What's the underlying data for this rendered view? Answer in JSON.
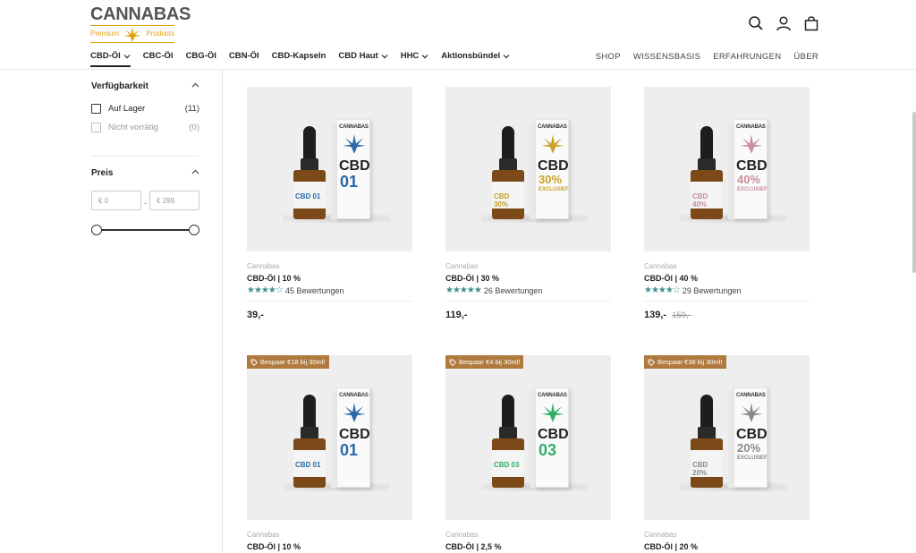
{
  "brand": {
    "name": "CANNABAS",
    "sub_left": "Premium",
    "sub_right": "Products",
    "accent": "#e0a20d"
  },
  "header_icons": [
    "search-icon",
    "account-icon",
    "cart-icon"
  ],
  "nav": {
    "items": [
      {
        "label": "CBD-Öl",
        "dropdown": true,
        "active": true
      },
      {
        "label": "CBC-Öl",
        "dropdown": false
      },
      {
        "label": "CBG-Öl",
        "dropdown": false
      },
      {
        "label": "CBN-Öl",
        "dropdown": false
      },
      {
        "label": "CBD-Kapseln",
        "dropdown": false
      },
      {
        "label": "CBD Haut",
        "dropdown": true
      },
      {
        "label": "HHC",
        "dropdown": true
      },
      {
        "label": "Aktionsbündel",
        "dropdown": true
      }
    ],
    "right": [
      "SHOP",
      "WISSENSBASIS",
      "ERFAHRUNGEN",
      "ÜBER"
    ]
  },
  "filters": {
    "availability": {
      "title": "Verfügbarkeit",
      "options": [
        {
          "label": "Auf Lager",
          "count": "(11)",
          "disabled": false
        },
        {
          "label": "Nicht vorrätig",
          "count": "(0)",
          "disabled": true
        }
      ]
    },
    "price": {
      "title": "Preis",
      "min_placeholder": "€ 0",
      "max_placeholder": "€ 299",
      "separator": "-"
    }
  },
  "products": [
    {
      "vendor": "Cannabas",
      "name": "CBD-Öl | 10 %",
      "rating_stars": 4.5,
      "reviews": "45 Bewertungen",
      "price": "39,-",
      "old_price": "",
      "badge": "",
      "box_number": "01",
      "box_color": "#2a6aa8",
      "box_excl": "",
      "label_text": "CBD 01"
    },
    {
      "vendor": "Cannabas",
      "name": "CBD-Öl | 30 %",
      "rating_stars": 5,
      "reviews": "26 Bewertungen",
      "price": "119,-",
      "old_price": "",
      "badge": "",
      "box_number": "30%",
      "box_color": "#c9a227",
      "box_excl": "EXCLUSIEF",
      "label_text": "CBD 30%"
    },
    {
      "vendor": "Cannabas",
      "name": "CBD-Öl | 40 %",
      "rating_stars": 4.5,
      "reviews": "29 Bewertungen",
      "price": "139,-",
      "old_price": "159,-",
      "badge": "",
      "box_number": "40%",
      "box_color": "#c98e9a",
      "box_excl": "EXCLUSIEF",
      "label_text": "CBD 40%"
    },
    {
      "vendor": "Cannabas",
      "name": "CBD-Öl | 10 %",
      "rating_stars": 0,
      "reviews": "",
      "price": "",
      "old_price": "",
      "badge": "Bespaar €18 bij 30ml!",
      "box_number": "01",
      "box_color": "#2a6aa8",
      "box_excl": "",
      "label_text": "CBD 01"
    },
    {
      "vendor": "Cannabas",
      "name": "CBD-Öl | 2,5 %",
      "rating_stars": 0,
      "reviews": "",
      "price": "",
      "old_price": "",
      "badge": "Bespaar €4 bij 30ml!",
      "box_number": "03",
      "box_color": "#2fae6a",
      "box_excl": "",
      "label_text": "CBD 03"
    },
    {
      "vendor": "Cannabas",
      "name": "CBD-Öl | 20 %",
      "rating_stars": 0,
      "reviews": "",
      "price": "",
      "old_price": "",
      "badge": "Bespaar €38 bij 30ml!",
      "box_number": "20%",
      "box_color": "#8a8a8a",
      "box_excl": "EXCLUSIEF",
      "label_text": "CBD 20%"
    }
  ],
  "colors": {
    "star": "#3e8f8e",
    "badge": "#b07a3e"
  }
}
